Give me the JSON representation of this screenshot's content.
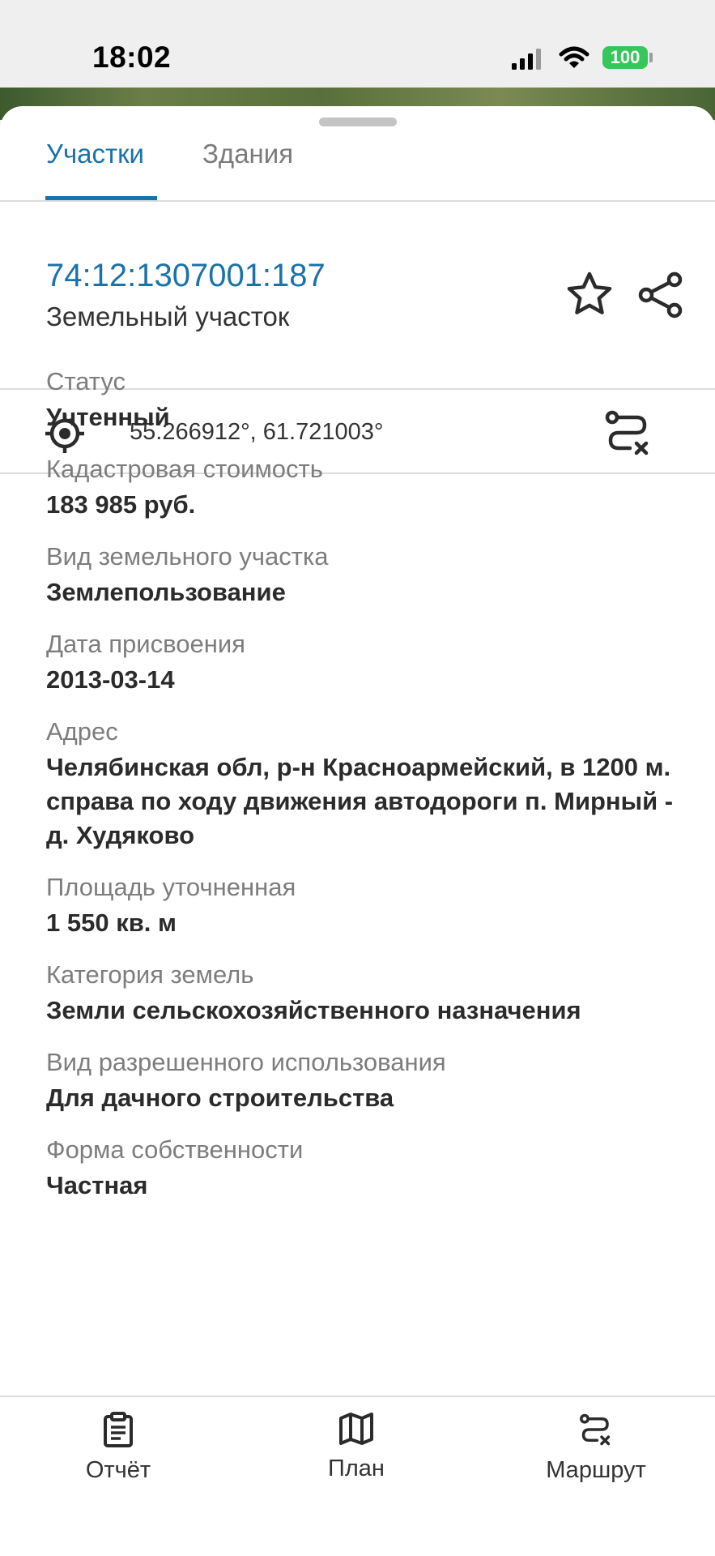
{
  "status_bar": {
    "time": "18:02",
    "battery": "100"
  },
  "tabs": [
    {
      "label": "Участки",
      "active": true
    },
    {
      "label": "Здания",
      "active": false
    }
  ],
  "parcel": {
    "cadastral_number": "74:12:1307001:187",
    "type": "Земельный участок",
    "coordinates": "55.266912°, 61.721003°"
  },
  "info": [
    {
      "label": "Статус",
      "value": "Учтенный"
    },
    {
      "label": "Кадастровая стоимость",
      "value": "183 985 руб."
    },
    {
      "label": "Вид земельного участка",
      "value": "Землепользование"
    },
    {
      "label": "Дата присвоения",
      "value": "2013-03-14"
    },
    {
      "label": "Адрес",
      "value": "Челябинская обл, р-н Красноармейский, в 1200 м. справа по ходу движения автодороги п. Мирный - д. Худяково"
    },
    {
      "label": "Площадь уточненная",
      "value": "1 550 кв. м"
    },
    {
      "label": "Категория земель",
      "value": "Земли сельскохозяйственного назначения"
    },
    {
      "label": "Вид разрешенного использования",
      "value": "Для дачного строительства"
    },
    {
      "label": "Форма собственности",
      "value": "Частная"
    }
  ],
  "bottom_nav": [
    {
      "label": "Отчёт",
      "icon": "clipboard-icon"
    },
    {
      "label": "План",
      "icon": "map-icon"
    },
    {
      "label": "Маршрут",
      "icon": "route-icon"
    }
  ],
  "colors": {
    "accent": "#1a73a8",
    "battery": "#34c759"
  }
}
